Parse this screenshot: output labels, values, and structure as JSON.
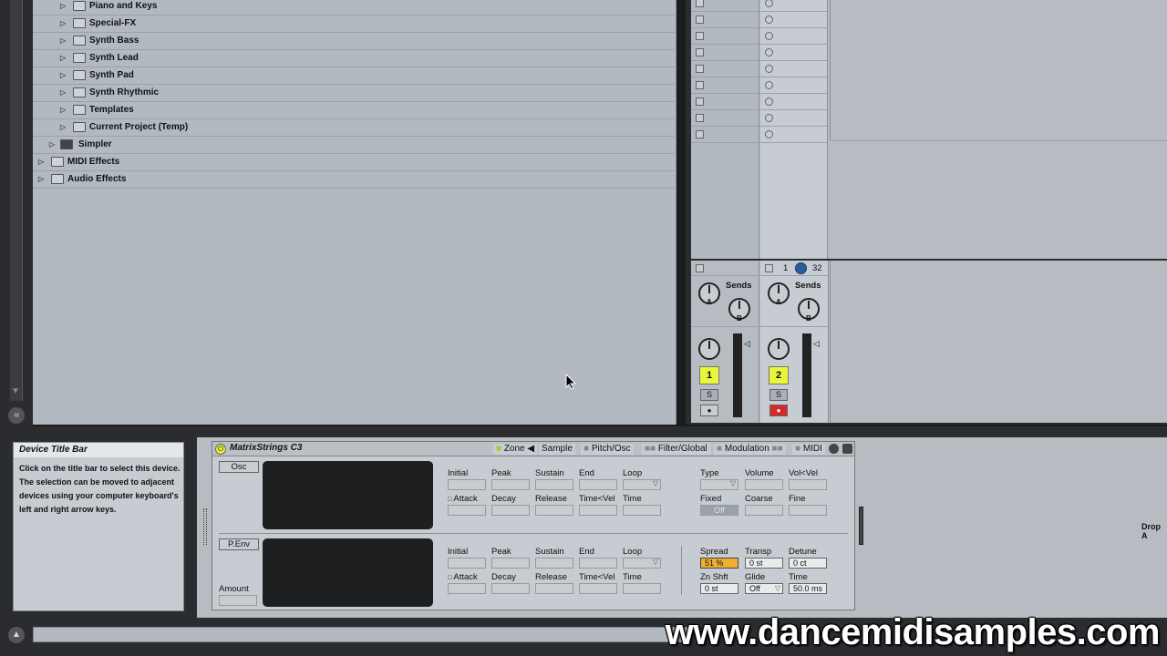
{
  "browser": {
    "items": [
      {
        "label": "Piano and Keys",
        "depth": 2
      },
      {
        "label": "Special-FX",
        "depth": 2
      },
      {
        "label": "Synth Bass",
        "depth": 2
      },
      {
        "label": "Synth Lead",
        "depth": 2
      },
      {
        "label": "Synth Pad",
        "depth": 2
      },
      {
        "label": "Synth Rhythmic",
        "depth": 2
      },
      {
        "label": "Templates",
        "depth": 2
      },
      {
        "label": "Current Project (Temp)",
        "depth": 2
      },
      {
        "label": "Simpler",
        "depth": 1
      },
      {
        "label": "MIDI Effects",
        "depth": 0
      },
      {
        "label": "Audio Effects",
        "depth": 0
      }
    ]
  },
  "mixer": {
    "track2_header": {
      "num": "1",
      "value": "32"
    },
    "sends_label": "Sends",
    "send_a": "A",
    "send_b": "B",
    "track1_number": "1",
    "track2_number": "2",
    "solo_label": "S"
  },
  "info": {
    "title": "Device Title Bar",
    "text": "Click on the title bar to select this device. The selection can be moved to adjacent devices using your computer keyboard's left and right arrow keys."
  },
  "device": {
    "title": "MatrixStrings C3",
    "tabs": [
      "Zone",
      "Sample",
      "Pitch/Osc",
      "Filter/Global",
      "Modulation",
      "MIDI"
    ],
    "osc_label": "Osc",
    "penv_label": "P.Env",
    "amount_label": "Amount",
    "env1": {
      "row1": [
        "Initial",
        "Peak",
        "Sustain",
        "End",
        "Loop"
      ],
      "row2": [
        "Attack",
        "Decay",
        "Release",
        "Time<Vel",
        "Time"
      ]
    },
    "env2": {
      "row1": [
        "Initial",
        "Peak",
        "Sustain",
        "End",
        "Loop"
      ],
      "row2": [
        "Attack",
        "Decay",
        "Release",
        "Time<Vel",
        "Time"
      ]
    },
    "osc_right": {
      "row1": [
        "Type",
        "Volume",
        "Vol<Vel"
      ],
      "row2": [
        "Fixed",
        "Coarse",
        "Fine"
      ],
      "fixed_value": "Off"
    },
    "pitch_right": {
      "spread_label": "Spread",
      "spread_value": "51 %",
      "transp_label": "Transp",
      "transp_value": "0 st",
      "detune_label": "Detune",
      "detune_value": "0 ct",
      "znshft_label": "Zn Shft",
      "znshft_value": "0 st",
      "glide_label": "Glide",
      "glide_value": "Off",
      "time_label": "Time",
      "time_value": "50.0 ms"
    }
  },
  "right_panel": {
    "drop_text": "Drop A"
  },
  "watermark": "www.dancemidisamples.com",
  "colors": {
    "track_yellow": "#e8f53a",
    "arm_red": "#d42a2a",
    "spread_orange": "#f0b030"
  }
}
